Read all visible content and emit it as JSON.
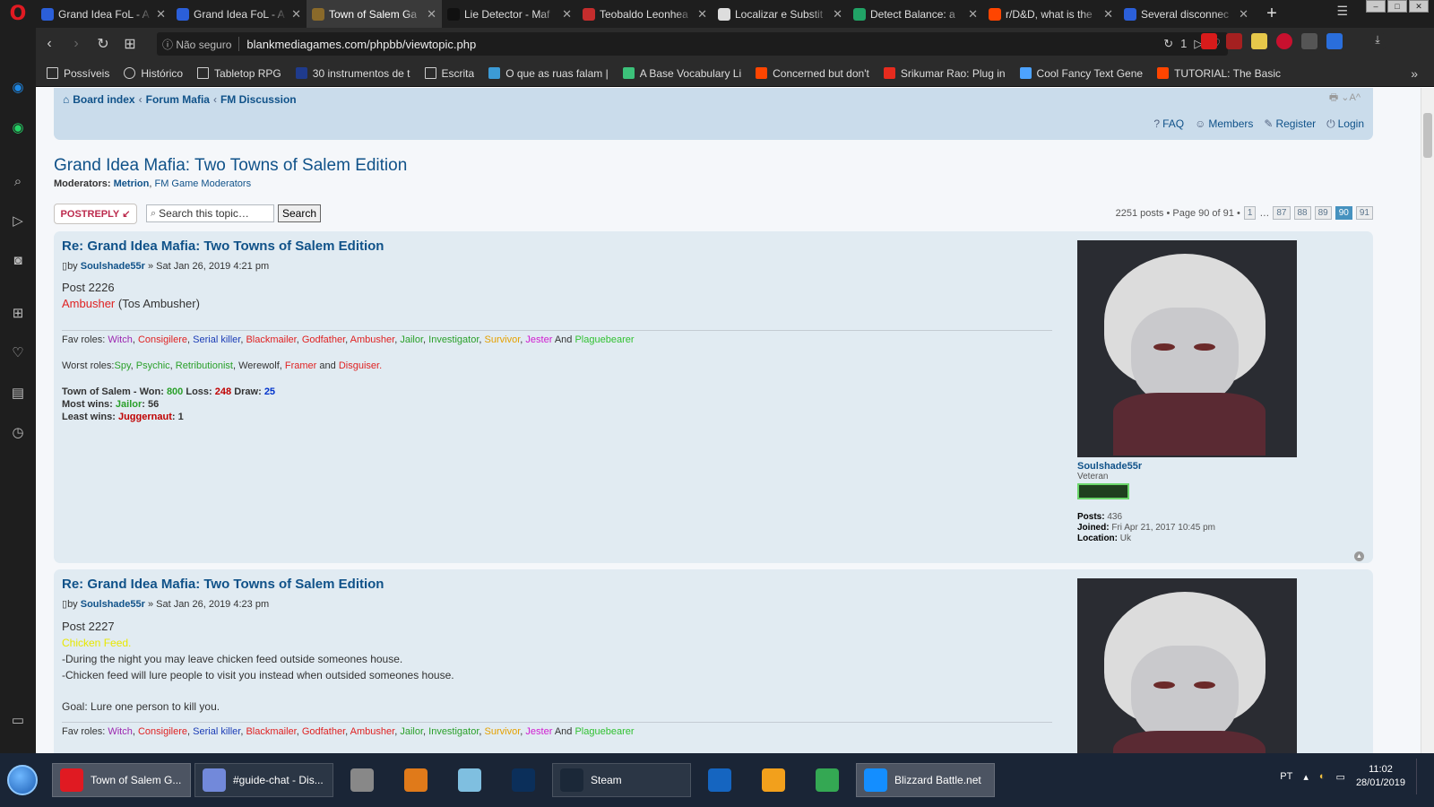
{
  "browser": {
    "tabs": [
      {
        "label": "Grand Idea FoL - A",
        "color": "#2b5fd9"
      },
      {
        "label": "Grand Idea FoL - A",
        "color": "#2b5fd9"
      },
      {
        "label": "Town of Salem Ga",
        "color": "#8a6a2a"
      },
      {
        "label": "Lie Detector - Maf",
        "color": "#111111"
      },
      {
        "label": "Teobaldo Leonhea",
        "color": "#c42d2d"
      },
      {
        "label": "Localizar e Substit",
        "color": "#dddddd"
      },
      {
        "label": "Detect Balance: a",
        "color": "#21a366"
      },
      {
        "label": "r/D&D, what is the",
        "color": "#ff4500"
      },
      {
        "label": "Several disconnec",
        "color": "#2b5fd9"
      }
    ],
    "active_tab_index": 2,
    "address": {
      "security_label": "Não seguro",
      "url": "blankmediagames.com/phpbb/viewtopic.php",
      "badge_count": "1"
    },
    "bookmarks": [
      {
        "label": "Possíveis",
        "type": "folder",
        "color": "#cccccc"
      },
      {
        "label": "Histórico",
        "type": "clock",
        "color": "#cccccc"
      },
      {
        "label": "Tabletop RPG",
        "type": "folder",
        "color": "#cccccc"
      },
      {
        "label": "30 instrumentos de t",
        "type": "site",
        "color": "#1f3b8c"
      },
      {
        "label": "Escrita",
        "type": "folder",
        "color": "#cccccc"
      },
      {
        "label": "O que as ruas falam |",
        "type": "site",
        "color": "#3c9bd6"
      },
      {
        "label": "A Base Vocabulary Li",
        "type": "site",
        "color": "#3cc17a"
      },
      {
        "label": "Concerned but don't",
        "type": "site",
        "color": "#ff4500"
      },
      {
        "label": "Srikumar Rao: Plug in",
        "type": "site",
        "color": "#e62b1e"
      },
      {
        "label": "Cool Fancy Text Gene",
        "type": "site",
        "color": "#4da3ff"
      },
      {
        "label": "TUTORIAL: The Basic",
        "type": "site",
        "color": "#ff4500"
      }
    ]
  },
  "forum": {
    "breadcrumb": [
      "Board index",
      "Forum Mafia",
      "FM Discussion"
    ],
    "header_links": {
      "faq": "FAQ",
      "members": "Members",
      "register": "Register",
      "login": "Login"
    },
    "topic_title": "Grand Idea Mafia: Two Towns of Salem Edition",
    "moderators_label": "Moderators:",
    "moderators": [
      "Metrion",
      "FM Game Moderators"
    ],
    "post_reply_label": "POSTREPLY",
    "search_placeholder": "Search this topic…",
    "search_button": "Search",
    "pagination": {
      "summary": "2251 posts • Page 90 of 91 •",
      "pages": [
        "1",
        "87",
        "88",
        "89",
        "90",
        "91"
      ],
      "ellipsis": "…",
      "current": "90"
    },
    "posts": [
      {
        "title": "Re: Grand Idea Mafia: Two Towns of Salem Edition",
        "by": "by",
        "author": "Soulshade55r",
        "date": "» Sat Jan 26, 2019 4:21 pm",
        "post_number": "Post 2226",
        "role_name": "Ambusher",
        "role_note": "(Tos Ambusher)",
        "profile": {
          "username": "Soulshade55r",
          "rank": "Veteran",
          "posts_label": "Posts:",
          "posts": "436",
          "joined_label": "Joined:",
          "joined": "Fri Apr 21, 2017 10:45 pm",
          "location_label": "Location:",
          "location": "Uk"
        }
      },
      {
        "title": "Re: Grand Idea Mafia: Two Towns of Salem Edition",
        "by": "by",
        "author": "Soulshade55r",
        "date": "» Sat Jan 26, 2019 4:23 pm",
        "post_number": "Post 2227",
        "role_name": "Chicken Feed.",
        "line1": "-During the night you may leave chicken feed outside someones house.",
        "line2": "-Chicken feed will lure people to visit you instead when outsided someones house.",
        "goal": "Goal: Lure one person to kill you."
      }
    ],
    "signature": {
      "fav_label": "Fav roles:",
      "fav": [
        "Witch",
        "Consigilere",
        "Serial killer",
        "Blackmailer",
        "Godfather",
        "Ambusher",
        "Jailor",
        "Investigator",
        "Survivor",
        "Jester"
      ],
      "fav_and": "And",
      "fav_last": "Plaguebearer",
      "worst_label": "Worst roles:",
      "worst": [
        "Spy",
        "Psychic",
        "Retributionist",
        "Werewolf",
        "Framer"
      ],
      "worst_and": "and",
      "worst_last": "Disguiser.",
      "tos_label": "Town of Salem - Won:",
      "won": "800",
      "loss_label": "Loss:",
      "loss": "248",
      "draw_label": "Draw:",
      "draw": "25",
      "most_label": "Most wins:",
      "most_role": "Jailor",
      "most_count": ": 56",
      "least_label": "Least wins:",
      "least_role": "Juggernaut",
      "least_count": ": 1"
    }
  },
  "taskbar": {
    "items": [
      {
        "label": "Town of Salem G...",
        "color": "#e01a22",
        "active": true
      },
      {
        "label": "#guide-chat - Dis...",
        "color": "#7289da",
        "active": false
      },
      {
        "label": "Overwatch",
        "color": "#888888",
        "icon_only": true
      },
      {
        "label": "Microphone",
        "color": "#e07a1a",
        "icon_only": true
      },
      {
        "label": "Notepad",
        "color": "#7fbfe0",
        "icon_only": true
      },
      {
        "label": "Photoshop",
        "color": "#0b2f5a",
        "icon_only": true
      },
      {
        "label": "Steam",
        "color": "#1b2838",
        "active": false
      },
      {
        "label": "Malwarebytes",
        "color": "#1565c0",
        "icon_only": true
      },
      {
        "label": "R",
        "color": "#f2a01c",
        "icon_only": true
      },
      {
        "label": "Chrome",
        "color": "#34a853",
        "icon_only": true
      },
      {
        "label": "Blizzard Battle.net",
        "color": "#148eff",
        "active": true
      }
    ],
    "lang": "PT",
    "time": "11:02",
    "date": "28/01/2019"
  }
}
